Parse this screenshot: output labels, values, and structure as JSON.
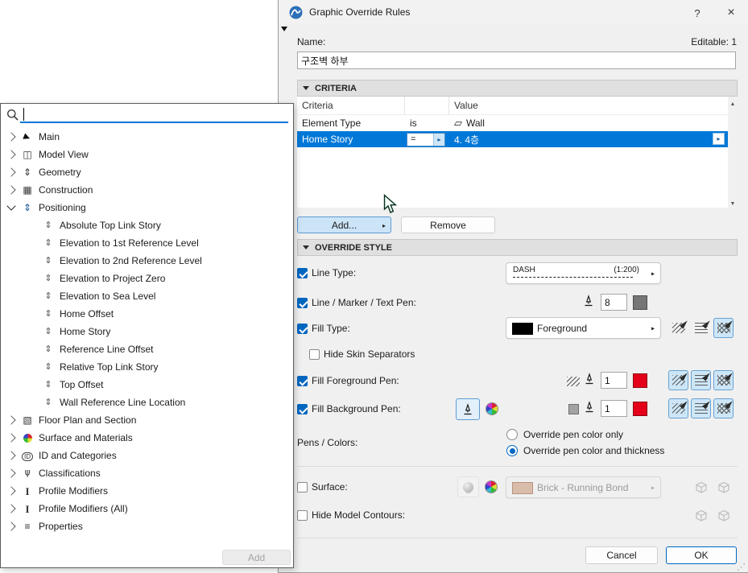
{
  "dialog": {
    "title": "Graphic Override Rules",
    "help_label": "?",
    "close_label": "×",
    "name_label": "Name:",
    "editable_label": "Editable: 1",
    "name_value": "구조벽 하부",
    "criteria": {
      "section_label": "CRITERIA",
      "columns": {
        "criteria": "Criteria",
        "value": "Value"
      },
      "rows": [
        {
          "criteria": "Element Type",
          "operator": "is",
          "value": "Wall",
          "icon": "wall"
        },
        {
          "criteria": "Home Story",
          "operator": "=",
          "value": "4. 4층",
          "selected": true
        }
      ],
      "add_label": "Add...",
      "remove_label": "Remove"
    },
    "override": {
      "section_label": "OVERRIDE STYLE",
      "line_type": {
        "label": "Line Type:",
        "checked": true,
        "value": "DASH",
        "scale": "(1:200)"
      },
      "line_marker_text_pen": {
        "label": "Line / Marker / Text Pen:",
        "checked": true,
        "value": "8"
      },
      "fill_type": {
        "label": "Fill Type:",
        "checked": true,
        "value": "Foreground"
      },
      "hide_skin_separators": {
        "label": "Hide Skin Separators",
        "checked": false
      },
      "fill_foreground_pen": {
        "label": "Fill Foreground Pen:",
        "checked": true,
        "value": "1"
      },
      "fill_background_pen": {
        "label": "Fill Background Pen:",
        "checked": true,
        "value": "1"
      },
      "pens_colors": {
        "label": "Pens / Colors:",
        "options": [
          {
            "label": "Override pen color only",
            "selected": false
          },
          {
            "label": "Override pen color and thickness",
            "selected": true
          }
        ]
      },
      "surface": {
        "label": "Surface:",
        "checked": false,
        "value": "Brick - Running Bond"
      },
      "hide_model_contours": {
        "label": "Hide Model Contours:",
        "checked": false
      }
    },
    "cancel_label": "Cancel",
    "ok_label": "OK"
  },
  "tree": {
    "search_value": "",
    "items": [
      {
        "label": "Main",
        "icon": "cursor",
        "type": "category",
        "expanded": false
      },
      {
        "label": "Model View",
        "icon": "model-view",
        "type": "category",
        "expanded": false
      },
      {
        "label": "Geometry",
        "icon": "geometry",
        "type": "category",
        "expanded": false
      },
      {
        "label": "Construction",
        "icon": "construction",
        "type": "category",
        "expanded": false
      },
      {
        "label": "Positioning",
        "icon": "positioning",
        "type": "category",
        "expanded": true
      },
      {
        "label": "Absolute Top Link Story",
        "icon": "positioning-property",
        "type": "child"
      },
      {
        "label": "Elevation to 1st Reference Level",
        "icon": "positioning-property",
        "type": "child"
      },
      {
        "label": "Elevation to 2nd Reference Level",
        "icon": "positioning-property",
        "type": "child"
      },
      {
        "label": "Elevation to Project Zero",
        "icon": "positioning-property",
        "type": "child"
      },
      {
        "label": "Elevation to Sea Level",
        "icon": "positioning-property",
        "type": "child"
      },
      {
        "label": "Home Offset",
        "icon": "positioning-property",
        "type": "child"
      },
      {
        "label": "Home Story",
        "icon": "positioning-property",
        "type": "child"
      },
      {
        "label": "Reference Line Offset",
        "icon": "positioning-property",
        "type": "child"
      },
      {
        "label": "Relative Top Link Story",
        "icon": "positioning-property",
        "type": "child"
      },
      {
        "label": "Top Offset",
        "icon": "positioning-property",
        "type": "child"
      },
      {
        "label": "Wall Reference Line Location",
        "icon": "positioning-property",
        "type": "child"
      },
      {
        "label": "Floor Plan and Section",
        "icon": "floor-plan",
        "type": "category",
        "expanded": false
      },
      {
        "label": "Surface and Materials",
        "icon": "surface-materials",
        "type": "category",
        "expanded": false
      },
      {
        "label": "ID and Categories",
        "icon": "id-categories",
        "type": "category",
        "expanded": false
      },
      {
        "label": "Classifications",
        "icon": "classifications",
        "type": "category",
        "expanded": false
      },
      {
        "label": "Profile Modifiers",
        "icon": "profile-modifiers",
        "type": "category",
        "expanded": false
      },
      {
        "label": "Profile Modifiers (All)",
        "icon": "profile-modifiers",
        "type": "category",
        "expanded": false
      },
      {
        "label": "Properties",
        "icon": "properties",
        "type": "category",
        "expanded": false
      }
    ],
    "add_label": "Add"
  },
  "colors": {
    "selection_blue": "#0078d7",
    "accent_blue": "#0067c0",
    "pen_red": "#e50019",
    "pen_gray": "#767676",
    "surface_swatch": "#d9bcaa",
    "fill_swatch_black": "#000000"
  }
}
